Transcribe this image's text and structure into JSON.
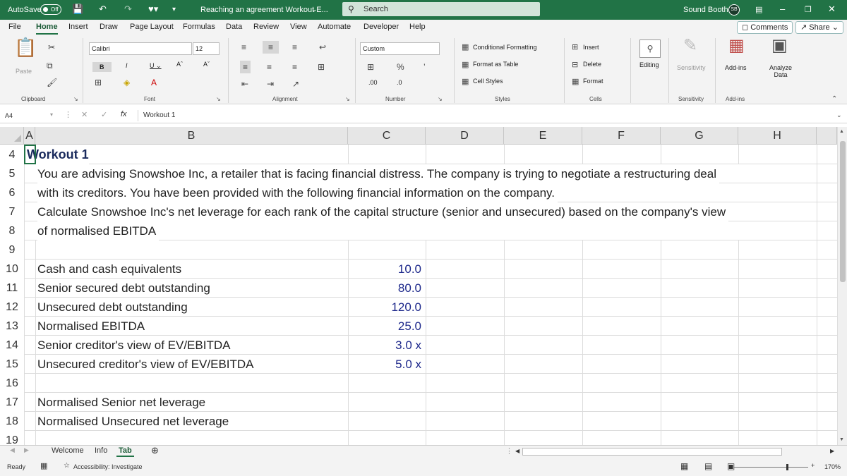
{
  "titlebar": {
    "autosave_label": "AutoSave",
    "autosave_state": "Off",
    "doc_title": "Reaching an agreement Workout E...",
    "search_placeholder": "Search",
    "user_name": "Sound Booth",
    "user_initials": "SB"
  },
  "menu": {
    "items": [
      "File",
      "Home",
      "Insert",
      "Draw",
      "Page Layout",
      "Formulas",
      "Data",
      "Review",
      "View",
      "Automate",
      "Developer",
      "Help"
    ],
    "comments_label": "Comments",
    "share_label": "Share"
  },
  "ribbon": {
    "paste": "Paste",
    "font_name": "Calibri",
    "font_size": "12",
    "number_format": "Custom",
    "conditional_formatting": "Conditional Formatting",
    "format_as_table": "Format as Table",
    "cell_styles": "Cell Styles",
    "insert": "Insert",
    "delete": "Delete",
    "format": "Format",
    "editing": "Editing",
    "sensitivity": "Sensitivity",
    "addins": "Add-ins",
    "analyze_data": "Analyze Data",
    "groups": {
      "clipboard": "Clipboard",
      "font": "Font",
      "alignment": "Alignment",
      "number": "Number",
      "styles": "Styles",
      "cells": "Cells",
      "sensitivity": "Sensitivity",
      "addins": "Add-ins"
    }
  },
  "formula_bar": {
    "name_box": "A4",
    "formula": "Workout 1"
  },
  "grid": {
    "columns": [
      "A",
      "B",
      "C",
      "D",
      "E",
      "F",
      "G",
      "H"
    ],
    "rows": [
      "4",
      "5",
      "6",
      "7",
      "8",
      "9",
      "10",
      "11",
      "12",
      "13",
      "14",
      "15",
      "16",
      "17",
      "18",
      "19"
    ],
    "title": "Workout 1",
    "para_lines": [
      "You are advising Snowshoe Inc, a retailer that is facing financial distress. The company is trying to negotiate a restructuring deal",
      "with its creditors. You have been provided with the following financial information on the company.",
      "Calculate Snowshoe Inc's net leverage for each rank of the capital structure (senior and unsecured) based on the company's view",
      "of normalised EBITDA"
    ],
    "data_rows": [
      {
        "label": "Cash and  cash equivalents",
        "value": "10.0"
      },
      {
        "label": "Senior secured debt outstanding",
        "value": "80.0"
      },
      {
        "label": "Unsecured debt outstanding",
        "value": "120.0"
      },
      {
        "label": "Normalised EBITDA",
        "value": "25.0"
      },
      {
        "label": "Senior creditor's view of EV/EBITDA",
        "value": "3.0 x"
      },
      {
        "label": "Unsecured creditor's view of EV/EBITDA",
        "value": "5.0 x"
      }
    ],
    "output_rows": [
      "Normalised Senior net leverage",
      "Normalised Unsecured net leverage"
    ]
  },
  "sheets": {
    "tabs": [
      "Welcome",
      "Info",
      "Tab"
    ],
    "active": "Tab"
  },
  "status": {
    "ready": "Ready",
    "accessibility": "Accessibility: Investigate",
    "zoom": "170%"
  },
  "colors": {
    "accent": "#217346",
    "value_text": "#1f2a8c"
  }
}
